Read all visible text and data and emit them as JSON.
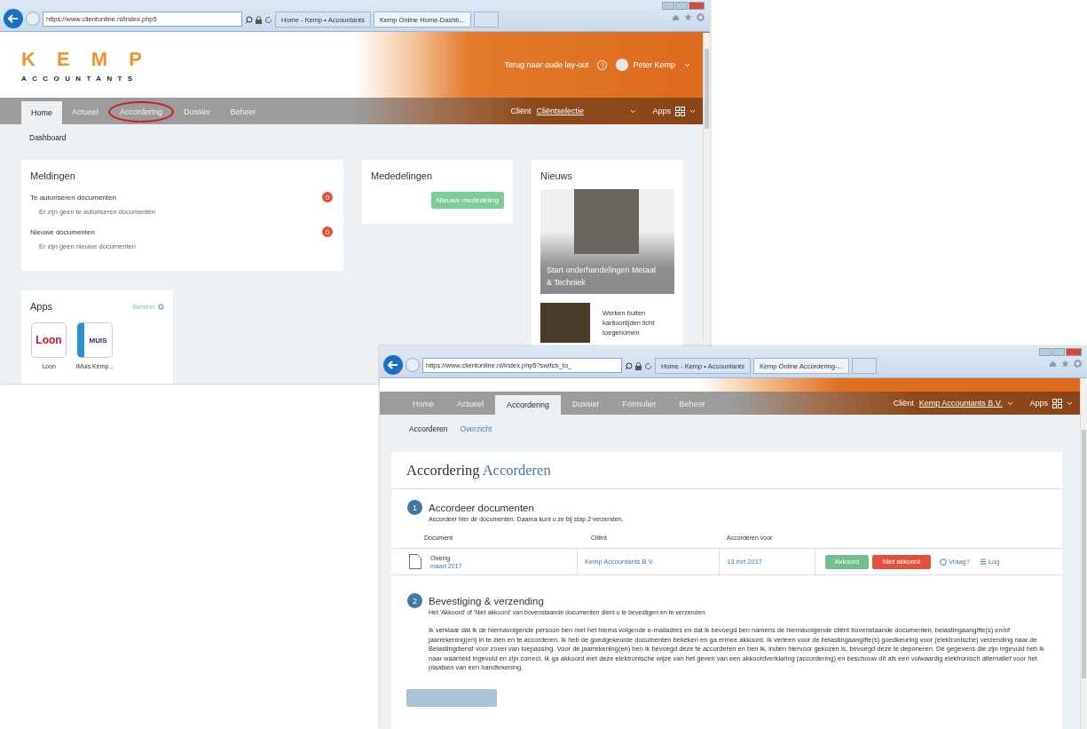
{
  "windows": [
    {
      "kind": "dashboard",
      "address": "https://www.clientonline.nl/index.php5",
      "tabs": [
        {
          "label": "Home - Kemp • Accountants",
          "selected": false
        },
        {
          "label": "Kemp Online Home-Dashb...",
          "selected": true
        }
      ],
      "logo": {
        "top": "K E M P",
        "bottom": "ACCOUNTANTS"
      },
      "old_layout_link": "Terug naar oude lay-out",
      "help": "?",
      "user": "Peter Kemp",
      "nav": [
        {
          "label": "Home",
          "selected": true,
          "circled": false
        },
        {
          "label": "Actueel",
          "selected": false,
          "circled": false
        },
        {
          "label": "Accordering",
          "selected": false,
          "circled": true
        },
        {
          "label": "Dossier",
          "selected": false,
          "circled": false
        },
        {
          "label": "Beheer",
          "selected": false,
          "circled": false
        }
      ],
      "client_label": "Cliënt",
      "client_value": "Cliëntselectie",
      "apps_label": "Apps",
      "subnav": [
        {
          "label": "Dashboard",
          "selected": true
        }
      ],
      "meldingen": {
        "title": "Meldingen",
        "items": [
          {
            "label": "Te autoriseren documenten",
            "count": "0",
            "empty": "Er zijn geen te autoriseren documenten"
          },
          {
            "label": "Nieuwe documenten",
            "count": "0",
            "empty": "Er zijn geen nieuwe documenten"
          }
        ]
      },
      "mededelingen": {
        "title": "Mededelingen",
        "button": "Nieuwe mededeling"
      },
      "nieuws": {
        "title": "Nieuws",
        "featured": "Start onderhandelingen Metaal & Techniek",
        "items": [
          {
            "title": "Werken buiten kantoortijden licht toegenomen"
          }
        ]
      },
      "apps": {
        "title": "Apps",
        "manage": "Beheer",
        "items": [
          {
            "logo": "Loon",
            "name": "Loon"
          },
          {
            "logo": "MUIS",
            "name": "iMuis Kemp..."
          }
        ]
      }
    },
    {
      "kind": "accordering",
      "address": "https://www.clientonline.nl/index.php5?switch_to_",
      "tabs": [
        {
          "label": "Home - Kemp • Accountants",
          "selected": false
        },
        {
          "label": "Kemp Online Accordering-...",
          "selected": true
        }
      ],
      "nav": [
        {
          "label": "Home",
          "selected": false,
          "circled": false
        },
        {
          "label": "Actueel",
          "selected": false,
          "circled": false
        },
        {
          "label": "Accordering",
          "selected": true,
          "circled": false
        },
        {
          "label": "Dossier",
          "selected": false,
          "circled": false
        },
        {
          "label": "Formulier",
          "selected": false,
          "circled": false
        },
        {
          "label": "Beheer",
          "selected": false,
          "circled": false
        }
      ],
      "client_label": "Cliënt",
      "client_value": "Kemp Accountants B.V.",
      "apps_label": "Apps",
      "subnav": [
        {
          "label": "Accorderen",
          "selected": true
        },
        {
          "label": "Overzicht",
          "selected": false
        }
      ],
      "title": {
        "main": "Accordering",
        "sub": "Accorderen"
      },
      "step1": {
        "number": "1",
        "title": "Accordeer documenten",
        "subtitle": "Accordeer hier de documenten. Daarna kunt u ze bij stap 2 verzenden.",
        "columns": [
          "Document",
          "Cliënt",
          "Accorderen voor"
        ],
        "rows": [
          {
            "document": "Overig",
            "period": "maart 2017",
            "client": "Kemp Accountants B.V.",
            "date": "13 mrt 2017",
            "approve": "Akkoord",
            "reject": "Niet akkoord",
            "question": "Vraag?",
            "log": "Log"
          }
        ]
      },
      "step2": {
        "number": "2",
        "title": "Bevestiging & verzending",
        "subtitle": "Het 'Akkoord' of 'Niet akkoord' van bovenstaande documenten dient u te bevestigen en te verzenden.",
        "text": "Ik verklaar dat ik de hiernavolgende persoon ben met het hierna volgende e-mailadres en dat ik bevoegd ben namens de hiernavolgende cliënt bovenstaande documenten, belastingaangifte(s) en/of jaarrekening(en) in te zien en te accorderen. Ik heb de goedgekeurde documenten bekeken en ga ermee akkoord. Ik verleen voor de belastingaangifte(s) goedkeuring voor (elektronische) verzending naar de Belastingdienst voor zover van toepassing. Voor de jaarrekening(en) ben ik bevoegd deze te accorderen en ben ik, indien hiervoor gekozen is, bevoegd deze te deponeren. De gegevens die zijn ingevuld heb ik naar waarheid ingevuld en zijn correct. Ik ga akkoord met deze elektronische wijze van het geven van een akkoordverklaring (accordering) en beschouw dit als een volwaardig elektronisch alternatief voor het plaatsen van een handtekening."
      }
    }
  ]
}
